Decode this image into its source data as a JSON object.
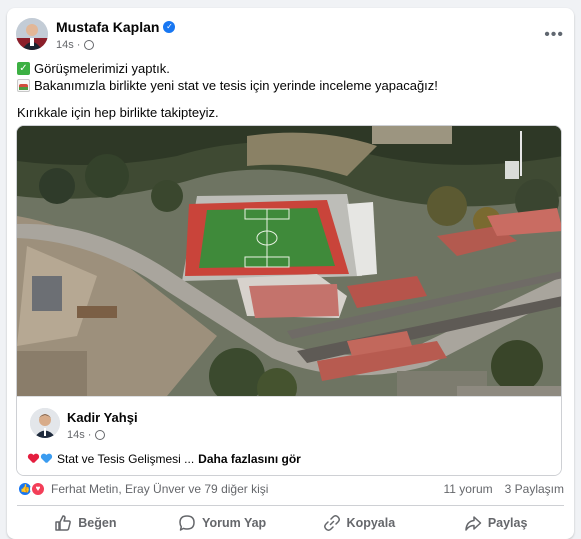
{
  "post": {
    "author": "Mustafa Kaplan",
    "time": "14s",
    "lines": [
      "Görüşmelerimizi yaptık.",
      "Bakanımızla birlikte yeni stat ve tesis için yerinde inceleme yapacağız!",
      "Kırıkkale için hep birlikte takipteyiz."
    ]
  },
  "shared": {
    "author": "Kadir Yahşi",
    "time": "14s",
    "text": "Stat ve Tesis Gelişmesi ...",
    "more_label": "Daha fazlasını gör"
  },
  "reactions": {
    "names": "Ferhat Metin, Eray Ünver ve 79 diğer kişi",
    "comments": "11 yorum",
    "shares": "3 Paylaşım"
  },
  "actions": {
    "like": "Beğen",
    "comment": "Yorum Yap",
    "copy": "Kopyala",
    "share": "Paylaş"
  },
  "colors": {
    "brand": "#1877f2",
    "love": "#f33e58",
    "track": "#c9443a",
    "pitch": "#3f8a3a"
  },
  "icons": [
    "verified-icon",
    "globe-icon",
    "more-icon",
    "check-emoji",
    "stadium-emoji",
    "heart-red-icon",
    "heart-blue-icon",
    "like-reaction-icon",
    "love-reaction-icon",
    "like-icon",
    "comment-icon",
    "copy-icon",
    "share-icon"
  ]
}
